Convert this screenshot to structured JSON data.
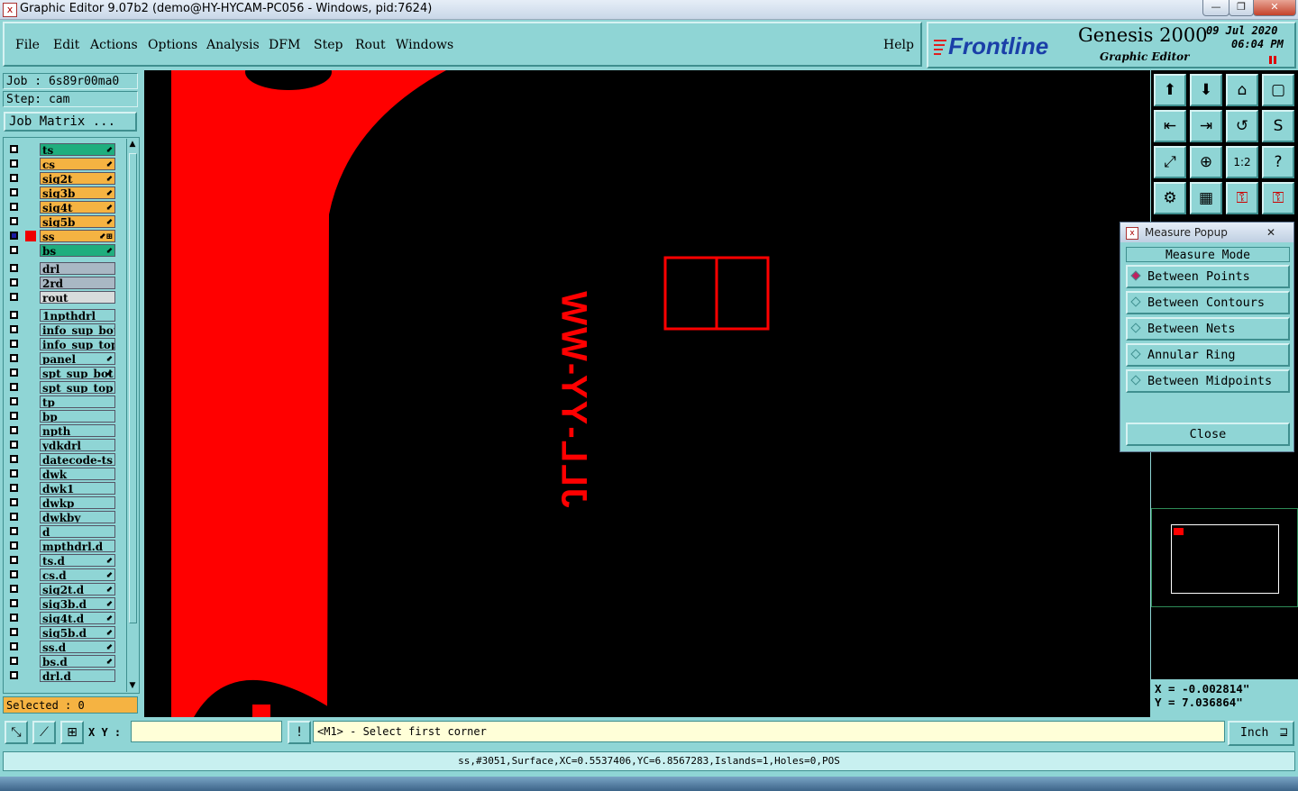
{
  "window": {
    "title": "Graphic Editor 9.07b2 (demo@HY-HYCAM-PC056 - Windows, pid:7624)",
    "app_icon": "x-app-icon",
    "minimize": "—",
    "maximize": "❐",
    "close": "✕"
  },
  "menu": {
    "items": [
      "File",
      "Edit",
      "Actions",
      "Options",
      "Analysis",
      "DFM",
      "Step",
      "Rout",
      "Windows"
    ],
    "help": "Help"
  },
  "brand": {
    "logo": "Frontline",
    "product": "Genesis 2000",
    "subtitle": "Graphic Editor",
    "date": "09 Jul 2020",
    "time": "06:04 PM"
  },
  "job": {
    "job_label": "Job : 6s89r00ma0",
    "step_label": "Step: cam",
    "matrix_button": "Job Matrix ..."
  },
  "layers": [
    {
      "name": "ts",
      "color": "#1fae7e",
      "flag": "⬋"
    },
    {
      "name": "cs",
      "color": "#f5b342",
      "flag": "⬋"
    },
    {
      "name": "sig2t",
      "color": "#f5b342",
      "flag": "⬋"
    },
    {
      "name": "sig3b",
      "color": "#f5b342",
      "flag": "⬋"
    },
    {
      "name": "sig4t",
      "color": "#f5b342",
      "flag": "⬋"
    },
    {
      "name": "sig5b",
      "color": "#f5b342",
      "flag": "⬋"
    },
    {
      "name": "ss",
      "color": "#f5b342",
      "flag": "⬋⊞"
    },
    {
      "name": "bs",
      "color": "#1fae7e",
      "flag": "⬋"
    },
    {
      "name": "drl",
      "color": "#a9b8c4",
      "flag": ""
    },
    {
      "name": "2rd",
      "color": "#a9b8c4",
      "flag": ""
    },
    {
      "name": "rout",
      "color": "#d8dcdc",
      "flag": ""
    },
    {
      "name": "1npthdrl",
      "color": "#8fd5d5",
      "flag": ""
    },
    {
      "name": "info_sup_bot",
      "color": "#8fd5d5",
      "flag": ""
    },
    {
      "name": "info_sup_top",
      "color": "#8fd5d5",
      "flag": ""
    },
    {
      "name": "panel",
      "color": "#8fd5d5",
      "flag": "⬋"
    },
    {
      "name": "spt_sup_bot",
      "color": "#8fd5d5",
      "flag": "⬋"
    },
    {
      "name": "spt_sup_top",
      "color": "#8fd5d5",
      "flag": ""
    },
    {
      "name": "tp",
      "color": "#8fd5d5",
      "flag": ""
    },
    {
      "name": "bp",
      "color": "#8fd5d5",
      "flag": ""
    },
    {
      "name": "npth",
      "color": "#8fd5d5",
      "flag": ""
    },
    {
      "name": "ydkdrl",
      "color": "#8fd5d5",
      "flag": ""
    },
    {
      "name": "datecode-ts",
      "color": "#8fd5d5",
      "flag": ""
    },
    {
      "name": "dwk",
      "color": "#8fd5d5",
      "flag": ""
    },
    {
      "name": "dwk1",
      "color": "#8fd5d5",
      "flag": ""
    },
    {
      "name": "dwkp",
      "color": "#8fd5d5",
      "flag": ""
    },
    {
      "name": "dwkby",
      "color": "#8fd5d5",
      "flag": ""
    },
    {
      "name": "d",
      "color": "#8fd5d5",
      "flag": ""
    },
    {
      "name": "mpthdrl.d",
      "color": "#8fd5d5",
      "flag": ""
    },
    {
      "name": "ts.d",
      "color": "#8fd5d5",
      "flag": "⬋"
    },
    {
      "name": "cs.d",
      "color": "#8fd5d5",
      "flag": "⬋"
    },
    {
      "name": "sig2t.d",
      "color": "#8fd5d5",
      "flag": "⬋"
    },
    {
      "name": "sig3b.d",
      "color": "#8fd5d5",
      "flag": "⬋"
    },
    {
      "name": "sig4t.d",
      "color": "#8fd5d5",
      "flag": "⬋"
    },
    {
      "name": "sig5b.d",
      "color": "#8fd5d5",
      "flag": "⬋"
    },
    {
      "name": "ss.d",
      "color": "#8fd5d5",
      "flag": "⬋"
    },
    {
      "name": "bs.d",
      "color": "#8fd5d5",
      "flag": "⬋"
    },
    {
      "name": "drl.d",
      "color": "#8fd5d5",
      "flag": ""
    }
  ],
  "selected": "Selected : 0",
  "canvas": {
    "silkscreen_text": "JLL-YY-WW",
    "layer_color": "#ff0000"
  },
  "toolbar_icons": [
    "zoom-home-icon",
    "zoom-page-icon",
    "house-icon",
    "grid-view-icon",
    "pan-left-icon",
    "pan-right-icon",
    "undo-icon",
    "snap-icon",
    "fit-icon",
    "zoom-center-icon",
    "one-to-two-icon",
    "help-icon",
    "cutter-icon",
    "grid-icon",
    "layers-red-icon",
    "layers-red2-icon"
  ],
  "toolbar_glyphs": [
    "⬆",
    "⬇",
    "⌂",
    "▢",
    "⇤",
    "⇥",
    "↺",
    "S",
    "⤢",
    "⊕",
    "1:2",
    "?",
    "⚙",
    "▦",
    "⚿",
    "⚿"
  ],
  "measure_popup": {
    "title": "Measure Popup",
    "mode_header": "Measure Mode",
    "options": [
      "Between Points",
      "Between Contours",
      "Between Nets",
      "Annular Ring",
      "Between Midpoints"
    ],
    "selected_index": 0,
    "close_label": "Close"
  },
  "coords": {
    "x": "X = -0.002814\"",
    "y": "Y = 7.036864\""
  },
  "bottom": {
    "xy_label": "X Y :",
    "xy_value": "",
    "prompt": "<M1> - Select first corner",
    "units": "Inch",
    "status_line": "ss,#3051,Surface,XC=0.5537406,YC=6.8567283,Islands=1,Holes=0,POS"
  }
}
